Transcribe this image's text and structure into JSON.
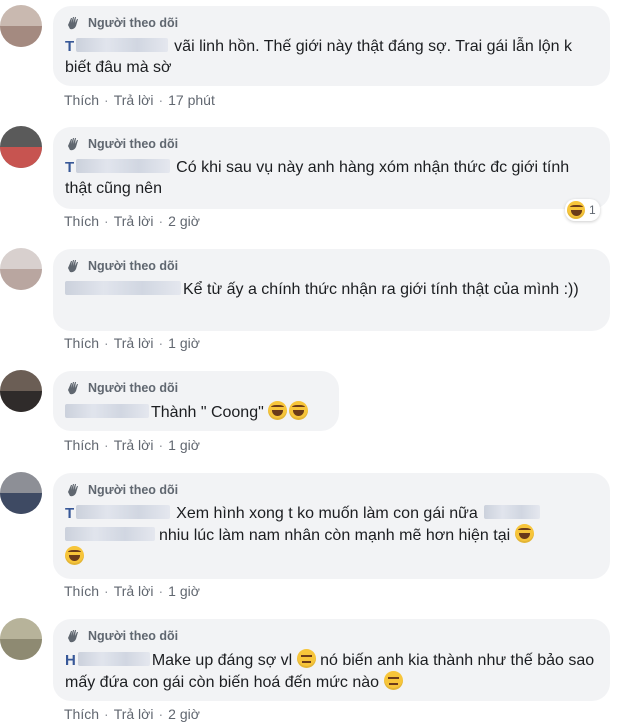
{
  "badge_label": "Người theo dõi",
  "actions": {
    "like": "Thích",
    "reply": "Trả lời"
  },
  "comments": [
    {
      "name_prefix": "T",
      "text_after_name": "vãi linh hồn. Thế giới này thật đáng sợ. Trai gái lẫn lộn k biết đâu mà sờ",
      "time": "17 phút"
    },
    {
      "name_prefix": "T",
      "text_after_name": "Có khi sau vụ này anh hàng xóm nhận thức đc giới tính thật cũng nên",
      "time": "2 giờ",
      "reaction_count": "1"
    },
    {
      "text_after_name": "Kể từ ấy a chính thức nhận ra giới tính thật của mình :))",
      "time": "1 giờ"
    },
    {
      "text_after_name": "Thành \" Coong\"",
      "time": "1 giờ"
    },
    {
      "name_prefix": "T",
      "text_after_name": "Xem hình xong t ko muốn làm con gái nữa",
      "text_line2": "nhiu lúc làm nam nhân còn mạnh mẽ hơn hiện tại",
      "time": "1 giờ"
    },
    {
      "name_prefix": "H",
      "text_after_name": "Make up đáng sợ vl",
      "text_mid": "nó biến anh kia thành như thế bảo sao mấy đứa con gái còn biến hoá đến mức nào",
      "time": "2 giờ"
    }
  ],
  "colors": {
    "bubble": "#f2f3f5",
    "action_text": "#616770",
    "name_link": "#385898",
    "emoji": "#f7c53a"
  },
  "icons": [
    "follower-hand-icon",
    "laugh-emoji-icon",
    "expressionless-emoji-icon",
    "avatar"
  ]
}
